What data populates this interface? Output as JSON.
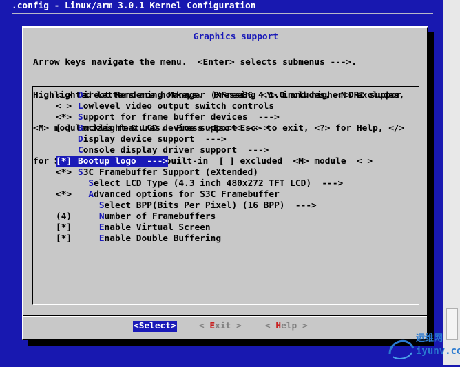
{
  "window": {
    "title": ".config - Linux/arm 3.0.1 Kernel Configuration"
  },
  "dialog": {
    "title": "Graphics support",
    "help_lines": [
      "Arrow keys navigate the menu.  <Enter> selects submenus --->.",
      "Highlighted letters are hotkeys.  Pressing <Y> includes, <N> excludes,",
      "<M> modularizes features.  Press <Esc><Esc> to exit, <?> for Help, </>",
      "for Search.  Legend: [*] built-in  [ ] excluded  <M> module  < >"
    ],
    "menu_items": [
      {
        "state": "< >",
        "indent": "",
        "hotkey": "D",
        "rest": "irect Rendering Manager (XFree86 4.1.0 and higher DRI suppor",
        "selected": false
      },
      {
        "state": "< >",
        "indent": "",
        "hotkey": "L",
        "rest": "owlevel video output switch controls",
        "selected": false
      },
      {
        "state": "<*>",
        "indent": "",
        "hotkey": "S",
        "rest": "upport for frame buffer devices  --->",
        "selected": false
      },
      {
        "state": "[ ]",
        "indent": "",
        "hotkey": "B",
        "rest": "acklight & LCD device support  --->",
        "selected": false
      },
      {
        "state": "",
        "indent": "",
        "hotkey": "D",
        "rest": "isplay device support  --->",
        "selected": false
      },
      {
        "state": "",
        "indent": "",
        "hotkey": "C",
        "rest": "onsole display driver support  --->",
        "selected": false
      },
      {
        "state": "[*]",
        "indent": "",
        "hotkey": "B",
        "rest": "ootup logo  --->",
        "selected": true
      },
      {
        "state": "<*>",
        "indent": "",
        "hotkey": "S",
        "rest": "3C Framebuffer Support (eXtended)",
        "selected": false
      },
      {
        "state": "",
        "indent": "  ",
        "hotkey": "S",
        "rest": "elect LCD Type (4.3 inch 480x272 TFT LCD)  --->",
        "selected": false
      },
      {
        "state": "<*>",
        "indent": "  ",
        "hotkey": "A",
        "rest": "dvanced options for S3C Framebuffer",
        "selected": false
      },
      {
        "state": "",
        "indent": "    ",
        "hotkey": "S",
        "rest": "elect BPP(Bits Per Pixel) (16 BPP)  --->",
        "selected": false
      },
      {
        "state": "(4)",
        "indent": "    ",
        "hotkey": "N",
        "rest": "umber of Framebuffers",
        "selected": false
      },
      {
        "state": "[*]",
        "indent": "    ",
        "hotkey": "E",
        "rest": "nable Virtual Screen",
        "selected": false
      },
      {
        "state": "[*]",
        "indent": "    ",
        "hotkey": "E",
        "rest": "nable Double Buffering",
        "selected": false
      }
    ],
    "buttons": {
      "select": {
        "open": "<",
        "hotkey": "S",
        "rest": "elect",
        "close": ">"
      },
      "exit": {
        "open": "< ",
        "hotkey": "E",
        "rest": "xit",
        "close": " >"
      },
      "help": {
        "open": "< ",
        "hotkey": "H",
        "rest": "elp",
        "close": " >"
      }
    }
  },
  "watermark": {
    "line1": "运维网",
    "line2": "iyunv.com"
  },
  "colors": {
    "background": "#1818b0",
    "dialog": "#c8c8c8",
    "hotkey": "#1a1ab8",
    "button_hotkey": "#c82020"
  },
  "icons": [
    "scrollbar",
    "watermark-logo-icon"
  ]
}
